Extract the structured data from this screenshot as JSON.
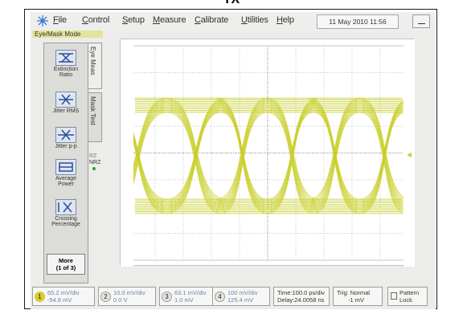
{
  "caption": "TX",
  "menu": {
    "items": [
      {
        "u": "F",
        "rest": "ile"
      },
      {
        "u": "C",
        "rest": "ontrol"
      },
      {
        "u": "S",
        "rest": "etup"
      },
      {
        "u": "M",
        "rest": "easure"
      },
      {
        "u": "C",
        "rest": "alibrate"
      },
      {
        "u": "U",
        "rest": "tilities"
      },
      {
        "u": "H",
        "rest": "elp"
      }
    ],
    "datetime": "11 May 2010  11:56"
  },
  "mode_label": "Eye/Mask Mode",
  "measurements": [
    {
      "label": "Extinction Ratio"
    },
    {
      "label": "Jitter RMS"
    },
    {
      "label": "Jitter p-p"
    },
    {
      "label": "Average Power"
    },
    {
      "label": "Crossing Percentage"
    }
  ],
  "more_button": {
    "line1": "More",
    "line2": "(1 of 3)"
  },
  "tabs": {
    "eye_meas": "Eye Meas",
    "mask_test": "Mask Test",
    "rz": "RZ",
    "nrz": "NRZ"
  },
  "channels": [
    {
      "num": "1",
      "line1": "65.2 mV/div",
      "line2": "-54.6 mV"
    },
    {
      "num": "2",
      "line1": "10.0 mV/div",
      "line2": "0.0 V"
    },
    {
      "num": "3",
      "line1": "63.1 mV/div",
      "line2": "1.0 mV"
    },
    {
      "num": "4",
      "line1": "100 mV/div",
      "line2": "125.4 mV"
    }
  ],
  "timebase": {
    "line1": "Time:100.0 ps/div",
    "line2": "Delay:24.0058 ns"
  },
  "trigger": {
    "line1": "Trig: Normal",
    "line2": "-1 mV"
  },
  "pattern_lock": {
    "line1": "Pattern",
    "line2": "Lock"
  },
  "colors": {
    "trace": "#c9cf2a",
    "channel1": "#d8cc2a",
    "grid": "#b0b0b0",
    "accent_blue": "#6d7fb0"
  }
}
